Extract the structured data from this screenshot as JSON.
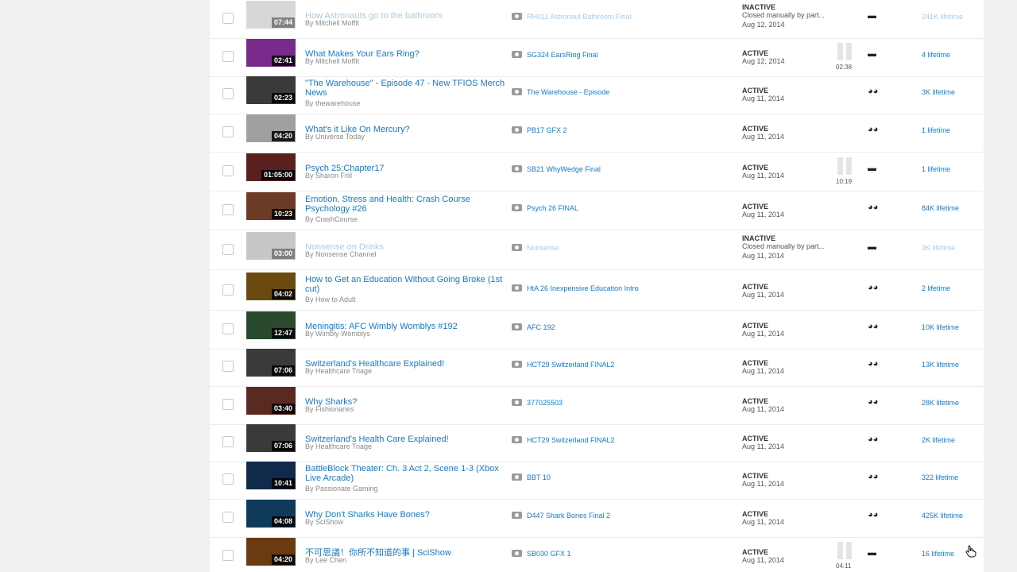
{
  "rows": [
    {
      "title": "How Astronauts go to the bathroom",
      "author": "By Mitchell Moffit",
      "duration": "07:44",
      "ad": "RH011 Astronaut Bathroom Final",
      "status": "INACTIVE",
      "status_note": "Closed manually by part...",
      "date": "Aug 12, 2014",
      "revenue": "241K lifetime",
      "bar_time": "",
      "glasses": "▬",
      "thumb_color": "#b8b8b8",
      "inactive": true
    },
    {
      "title": "What Makes Your Ears Ring?",
      "author": "By Mitchell Moffit",
      "duration": "02:41",
      "ad": "SG324 EarsRing Final",
      "status": "ACTIVE",
      "status_note": "",
      "date": "Aug 12, 2014",
      "revenue": "4 lifetime",
      "bar_time": "02:38",
      "glasses": "▬",
      "thumb_color": "#7a2a8a",
      "inactive": false
    },
    {
      "title": "\"The Warehouse\" - Episode 47 - New TFIOS Merch News",
      "author": "By thewarehouse",
      "duration": "02:23",
      "ad": "The Warehouse - Episode",
      "status": "ACTIVE",
      "status_note": "",
      "date": "Aug 11, 2014",
      "revenue": "3K lifetime",
      "bar_time": "",
      "glasses": "◕◕",
      "thumb_color": "#3a3a3a",
      "inactive": false
    },
    {
      "title": "What's it Like On Mercury?",
      "author": "By Universe Today",
      "duration": "04:20",
      "ad": "PB17 GFX 2",
      "status": "ACTIVE",
      "status_note": "",
      "date": "Aug 11, 2014",
      "revenue": "1 lifetime",
      "bar_time": "",
      "glasses": "◕◕",
      "thumb_color": "#a0a0a0",
      "inactive": false
    },
    {
      "title": "Psych 25:Chapter17",
      "author": "By Sharon Frill",
      "duration": "01:05:00",
      "ad": "SB21 WhyWedge Final",
      "status": "ACTIVE",
      "status_note": "",
      "date": "Aug 11, 2014",
      "revenue": "1 lifetime",
      "bar_time": "10:19",
      "glasses": "▬",
      "thumb_color": "#5a2020",
      "inactive": false
    },
    {
      "title": "Emotion, Stress and Health: Crash Course Psychology #26",
      "author": "By CrashCourse",
      "duration": "10:23",
      "ad": "Psych 26 FINAL",
      "status": "ACTIVE",
      "status_note": "",
      "date": "Aug 11, 2014",
      "revenue": "84K lifetime",
      "bar_time": "",
      "glasses": "◕◕",
      "thumb_color": "#6b3b25",
      "inactive": false
    },
    {
      "title": "Nonsense on Drinks",
      "author": "By Nonsense Channel",
      "duration": "03:00",
      "ad": "Nonsense",
      "status": "INACTIVE",
      "status_note": "Closed manually by part...",
      "date": "Aug 11, 2014",
      "revenue": "3K lifetime",
      "bar_time": "",
      "glasses": "▬",
      "thumb_color": "#9a9a9a",
      "inactive": true
    },
    {
      "title": "How to Get an Education Without Going Broke (1st cut)",
      "author": "By How to Adult",
      "duration": "04:02",
      "ad": "HtA 26 Inexpensive Education Intro",
      "status": "ACTIVE",
      "status_note": "",
      "date": "Aug 11, 2014",
      "revenue": "2 lifetime",
      "bar_time": "",
      "glasses": "◕◕",
      "thumb_color": "#6b4a10",
      "inactive": false
    },
    {
      "title": "Meningitis: AFC Wimbly Womblys #192",
      "author": "By Wimbly Womblys",
      "duration": "12:47",
      "ad": "AFC 192",
      "status": "ACTIVE",
      "status_note": "",
      "date": "Aug 11, 2014",
      "revenue": "10K lifetime",
      "bar_time": "",
      "glasses": "◕◕",
      "thumb_color": "#2a4a30",
      "inactive": false
    },
    {
      "title": "Switzerland's Healthcare Explained!",
      "author": "By Healthcare Triage",
      "duration": "07:06",
      "ad": "HCT29 Switzerland FINAL2",
      "status": "ACTIVE",
      "status_note": "",
      "date": "Aug 11, 2014",
      "revenue": "13K lifetime",
      "bar_time": "",
      "glasses": "◕◕",
      "thumb_color": "#3a3a3a",
      "inactive": false
    },
    {
      "title": "Why Sharks?",
      "author": "By Fishionaries",
      "duration": "03:40",
      "ad": "377025503",
      "status": "ACTIVE",
      "status_note": "",
      "date": "Aug 11, 2014",
      "revenue": "28K lifetime",
      "bar_time": "",
      "glasses": "◕◕",
      "thumb_color": "#5a2a20",
      "inactive": false
    },
    {
      "title": "Switzerland's Health Care Explained!",
      "author": "By Healthcare Triage",
      "duration": "07:06",
      "ad": "HCT29 Switzerland FINAL2",
      "status": "ACTIVE",
      "status_note": "",
      "date": "Aug 11, 2014",
      "revenue": "2K lifetime",
      "bar_time": "",
      "glasses": "◕◕",
      "thumb_color": "#3a3a3a",
      "inactive": false
    },
    {
      "title": "BattleBlock Theater: Ch. 3 Act 2, Scene 1-3 (Xbox Live Arcade)",
      "author": "By Passionate Gaming",
      "duration": "10:41",
      "ad": "BBT 10",
      "status": "ACTIVE",
      "status_note": "",
      "date": "Aug 11, 2014",
      "revenue": "322 lifetime",
      "bar_time": "",
      "glasses": "◕◕",
      "thumb_color": "#0f2a4a",
      "inactive": false
    },
    {
      "title": "Why Don't Sharks Have Bones?",
      "author": "By SciShow",
      "duration": "04:08",
      "ad": "D447 Shark Bones Final 2",
      "status": "ACTIVE",
      "status_note": "",
      "date": "Aug 11, 2014",
      "revenue": "425K lifetime",
      "bar_time": "",
      "glasses": "◕◕",
      "thumb_color": "#0f3a5a",
      "inactive": false
    },
    {
      "title": "不可思議！你所不知道的事 | SciShow",
      "author": "By Lee Chen",
      "duration": "04:20",
      "ad": "SB030 GFX 1",
      "status": "ACTIVE",
      "status_note": "",
      "date": "Aug 11, 2014",
      "revenue": "16 lifetime",
      "bar_time": "04:11",
      "glasses": "▬",
      "thumb_color": "#6a3a10",
      "inactive": false
    }
  ]
}
